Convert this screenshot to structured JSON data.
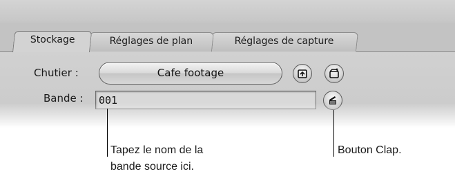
{
  "tabs": [
    {
      "label": "Stockage",
      "active": true
    },
    {
      "label": "Réglages de plan",
      "active": false
    },
    {
      "label": "Réglages de capture",
      "active": false
    }
  ],
  "form": {
    "bin_label": "Chutier :",
    "bin_button": "Cafe footage",
    "tape_label": "Bande :",
    "tape_value": "001"
  },
  "icons": {
    "import": "import-bin-icon",
    "new_bin": "new-bin-icon",
    "clap": "clapper-icon"
  },
  "callouts": {
    "tape_line1": "Tapez le nom de la",
    "tape_line2": "bande source ici.",
    "clap": "Bouton Clap."
  },
  "colors": {
    "panel_bg": "#c8c8c8",
    "field_bg": "#d9d9d9"
  }
}
